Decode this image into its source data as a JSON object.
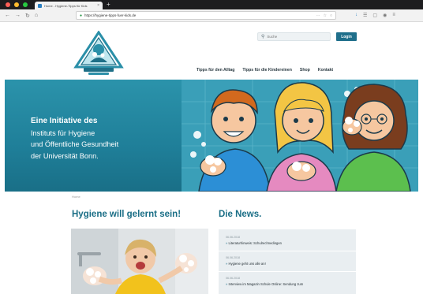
{
  "browser": {
    "tab_title": "Home - Hygiene-Tipps für Kids",
    "tab_close": "×",
    "new_tab": "+",
    "url": "https://hygiene-tipps-fuer-kids.de",
    "colors": {
      "close": "#ff5f57",
      "minimize": "#febc2e",
      "maximize": "#28c840"
    }
  },
  "header": {
    "search_placeholder": "Suche",
    "login_label": "Login",
    "nav": [
      "Tipps für den Alltag",
      "Tipps für die Kindereinen",
      "Shop",
      "Kontakt"
    ]
  },
  "hero": {
    "line1": "Eine Initiative des",
    "line2": "Instituts für Hygiene",
    "line3": "und Öffentliche Gesundheit",
    "line4": "der Universität Bonn."
  },
  "content": {
    "breadcrumb": "Home",
    "left_heading": "Hygiene will gelernt sein!",
    "right_heading": "Die News.",
    "news": [
      {
        "date": "06.06.2018",
        "title": "Literaturhinweis: Schulrechnedingen"
      },
      {
        "date": "06.06.2018",
        "title": "Hygiene geht uns alle an!"
      },
      {
        "date": "06.06.2018",
        "title": "Interview im Magazin Schule Online: Sendung zum"
      }
    ]
  },
  "theme": {
    "primary": "#1a6e86",
    "hero_bg": "#2389a3",
    "news_bg": "#e9eef1"
  }
}
